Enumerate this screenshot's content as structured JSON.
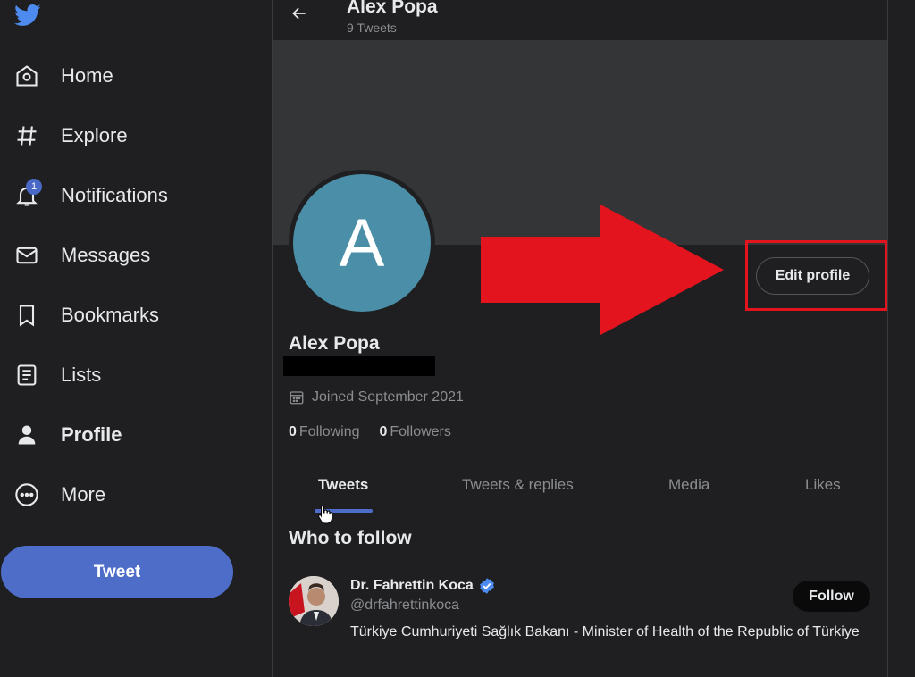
{
  "sidebar": {
    "items": [
      {
        "label": "Home",
        "icon": "home-icon"
      },
      {
        "label": "Explore",
        "icon": "hashtag-icon"
      },
      {
        "label": "Notifications",
        "icon": "bell-icon",
        "badge": "1"
      },
      {
        "label": "Messages",
        "icon": "envelope-icon"
      },
      {
        "label": "Bookmarks",
        "icon": "bookmark-icon"
      },
      {
        "label": "Lists",
        "icon": "list-icon"
      },
      {
        "label": "Profile",
        "icon": "person-icon",
        "active": true
      },
      {
        "label": "More",
        "icon": "more-circle-icon"
      }
    ],
    "tweet_button": "Tweet"
  },
  "header": {
    "name": "Alex Popa",
    "tweet_count": "9 Tweets"
  },
  "profile": {
    "avatar_letter": "A",
    "name": "Alex Popa",
    "joined": "Joined September 2021",
    "following_count": "0",
    "following_label": "Following",
    "followers_count": "0",
    "followers_label": "Followers",
    "edit_button": "Edit profile"
  },
  "tabs": [
    "Tweets",
    "Tweets & replies",
    "Media",
    "Likes"
  ],
  "who_to_follow": {
    "title": "Who to follow",
    "suggestion": {
      "name": "Dr. Fahrettin Koca",
      "handle": "@drfahrettinkoca",
      "bio": "Türkiye Cumhuriyeti Sağlık Bakanı - Minister of Health of the Republic of Türkiye",
      "follow_button": "Follow"
    }
  },
  "colors": {
    "accent": "#4d6dc9",
    "annotation_red": "#e3141e",
    "avatar_bg": "#4a8ea7",
    "verified": "#4d8bf0"
  }
}
